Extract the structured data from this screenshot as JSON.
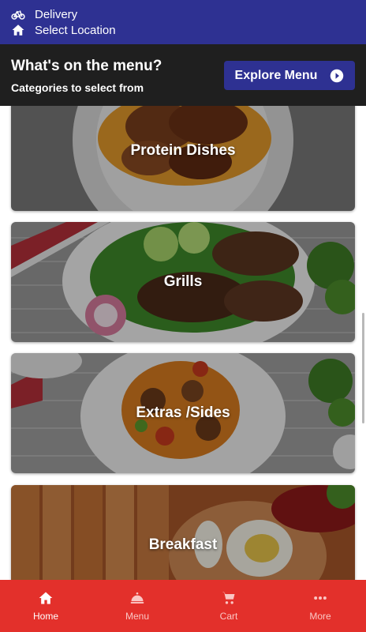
{
  "header": {
    "delivery_label": "Delivery",
    "location_label": "Select Location"
  },
  "menu_section": {
    "title": "What's on the menu?",
    "subtitle": "Categories to select from",
    "explore_button": "Explore Menu"
  },
  "categories": [
    {
      "label": "Protein Dishes"
    },
    {
      "label": "Grills"
    },
    {
      "label": "Extras /Sides"
    },
    {
      "label": "Breakfast"
    }
  ],
  "bottom_nav": [
    {
      "label": "Home",
      "icon": "home-icon",
      "active": true
    },
    {
      "label": "Menu",
      "icon": "cloche-icon",
      "active": false
    },
    {
      "label": "Cart",
      "icon": "cart-icon",
      "active": false
    },
    {
      "label": "More",
      "icon": "more-icon",
      "active": false
    }
  ],
  "colors": {
    "brand_blue": "#2e3192",
    "header_dark": "#1f1f1f",
    "nav_red": "#e3302b"
  }
}
